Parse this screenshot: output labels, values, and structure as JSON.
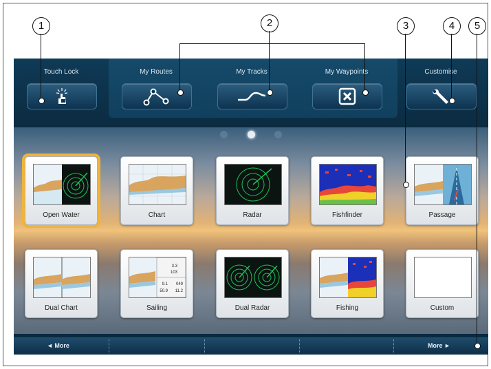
{
  "callouts": [
    "1",
    "2",
    "3",
    "4",
    "5"
  ],
  "topbar": {
    "touch_lock": "Touch Lock",
    "my_routes": "My Routes",
    "my_tracks": "My Tracks",
    "my_waypoints": "My Waypoints",
    "customise": "Customise"
  },
  "pager": {
    "pages": 3,
    "active_page": 2
  },
  "tiles_row1": [
    "Open Water",
    "Chart",
    "Radar",
    "Fishfinder",
    "Passage"
  ],
  "tiles_row2": [
    "Dual Chart",
    "Sailing",
    "Dual Radar",
    "Fishing",
    "Custom"
  ],
  "sailing_values": [
    "3.3",
    "103",
    "9.1",
    "049",
    "50.9",
    "11.2"
  ],
  "bottombar": {
    "more_left": "◄ More",
    "more_right": "More ►"
  },
  "colors": {
    "selection": "#f0b43a",
    "radar": "#21c05a",
    "bar": "#0d2e46"
  }
}
